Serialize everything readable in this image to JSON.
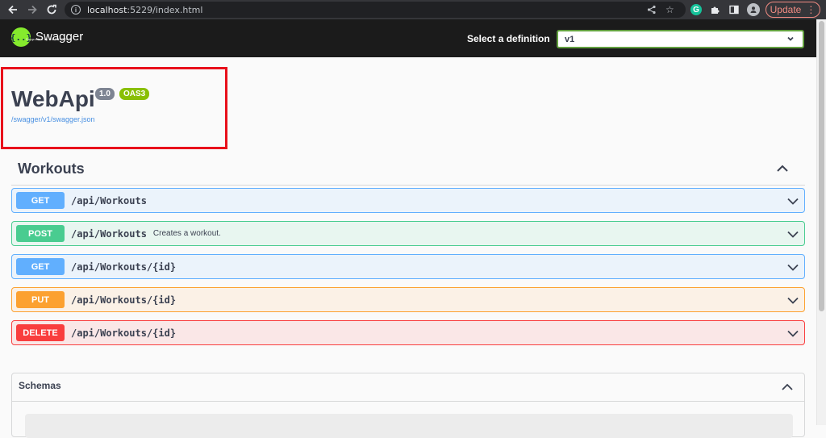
{
  "browser": {
    "url_host": "localhost",
    "url_rest": ":5229/index.html",
    "update_label": "Update"
  },
  "topbar": {
    "logo_text": "Swagger",
    "logo_sub": "Supported by SMARTBEAR",
    "definition_label": "Select a definition",
    "definition_value": "v1"
  },
  "info": {
    "title": "WebApi",
    "version": "1.0",
    "oas": "OAS3",
    "spec_url": "/swagger/v1/swagger.json"
  },
  "tag": {
    "name": "Workouts"
  },
  "operations": [
    {
      "method": "GET",
      "path": "/api/Workouts",
      "summary": ""
    },
    {
      "method": "POST",
      "path": "/api/Workouts",
      "summary": "Creates a workout."
    },
    {
      "method": "GET",
      "path": "/api/Workouts/{id}",
      "summary": ""
    },
    {
      "method": "PUT",
      "path": "/api/Workouts/{id}",
      "summary": ""
    },
    {
      "method": "DELETE",
      "path": "/api/Workouts/{id}",
      "summary": ""
    }
  ],
  "schemas": {
    "title": "Schemas"
  },
  "colors": {
    "get": "#61affe",
    "post": "#49cc90",
    "put": "#fca130",
    "delete": "#f93e3e",
    "highlight": "#e8101b"
  }
}
